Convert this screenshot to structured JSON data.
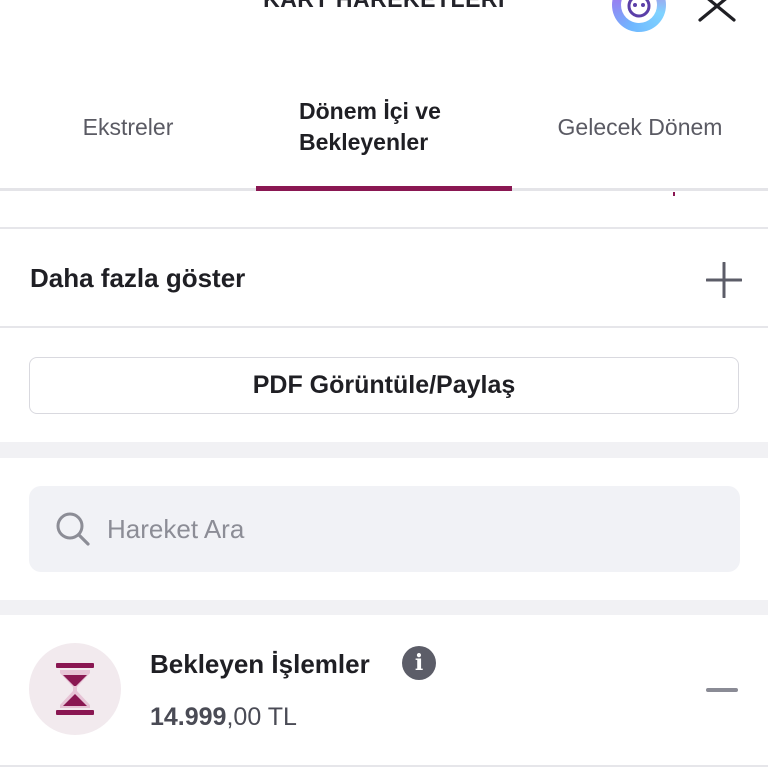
{
  "header": {
    "title": "KART HAREKETLERİ",
    "assistant_icon": "assistant-bot-icon",
    "close_icon": "close-icon"
  },
  "tabs": [
    {
      "label": "Ekstreler",
      "active": false
    },
    {
      "label_line1": "Dönem İçi ve",
      "label_line2": "Bekleyenler",
      "active": true
    },
    {
      "label": "Gelecek Dönem",
      "active": false
    }
  ],
  "more": {
    "label": "Daha fazla göster",
    "icon": "plus-icon"
  },
  "pdf_button": {
    "label": "PDF Görüntüle/Paylaş"
  },
  "search": {
    "placeholder": "Hareket Ara",
    "value": "",
    "icon": "search-icon"
  },
  "pending": {
    "title": "Bekleyen İşlemler",
    "amount_main": "14.999",
    "amount_fraction": ",00 TL",
    "icon": "hourglass-icon",
    "info_icon": "info-icon",
    "collapse_icon": "minus-icon"
  },
  "colors": {
    "accent": "#8a1752",
    "divider": "#e6e6ea",
    "search_bg": "#f1f2f6"
  }
}
